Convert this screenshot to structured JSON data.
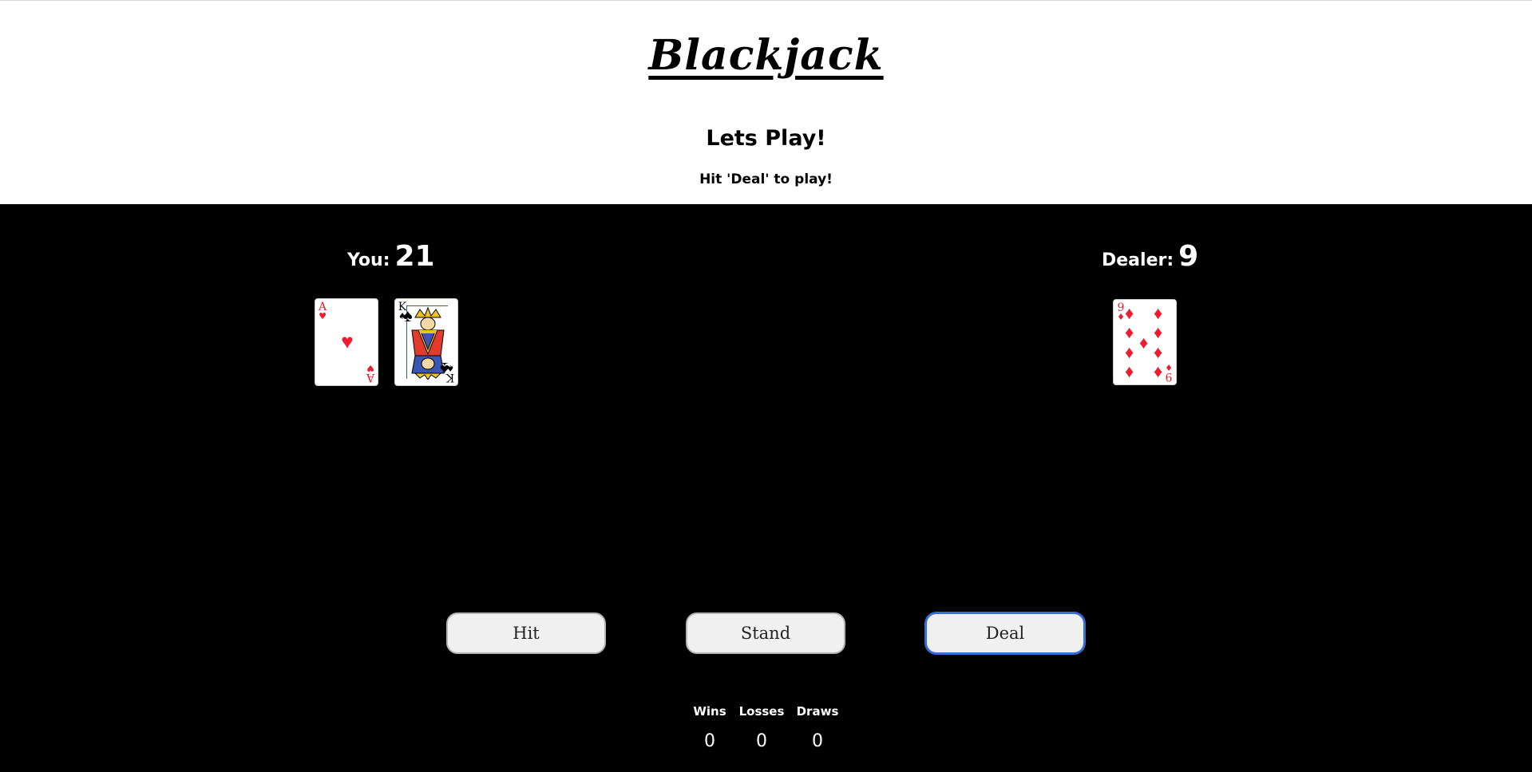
{
  "header": {
    "logo_text": "Blackjack",
    "headline": "Lets Play!",
    "subline": "Hit 'Deal' to play!"
  },
  "player": {
    "label": "You:",
    "score": "21",
    "cards": [
      {
        "rank": "A",
        "suit": "hearts",
        "suit_glyph": "♥",
        "color": "red"
      },
      {
        "rank": "K",
        "suit": "spades",
        "suit_glyph": "♠",
        "color": "black"
      }
    ]
  },
  "dealer": {
    "label": "Dealer:",
    "score": "9",
    "cards": [
      {
        "rank": "9",
        "suit": "diamonds",
        "suit_glyph": "♦",
        "color": "red"
      }
    ]
  },
  "buttons": {
    "hit": "Hit",
    "stand": "Stand",
    "deal": "Deal"
  },
  "stats": {
    "wins_label": "Wins",
    "losses_label": "Losses",
    "draws_label": "Draws",
    "wins": "0",
    "losses": "0",
    "draws": "0"
  },
  "colors": {
    "table": "#000000",
    "red_suit": "#ee1c2e",
    "focus_ring": "#3a6fd8"
  }
}
